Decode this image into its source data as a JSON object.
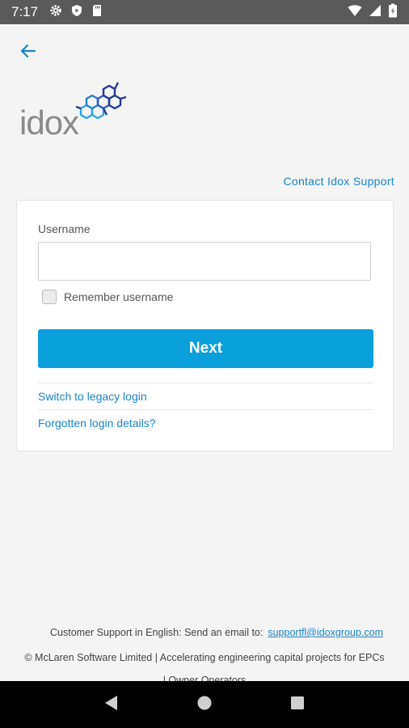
{
  "status_bar": {
    "time": "7:17",
    "left_icons": [
      "gear-icon",
      "shield-play-icon",
      "sd-card-icon"
    ],
    "right_icons": [
      "wifi-icon",
      "signal-icon",
      "battery-icon"
    ]
  },
  "header": {
    "back_icon": "arrow-left-icon",
    "logo_text": "idox",
    "contact_link": "Contact Idox Support"
  },
  "login_form": {
    "username_label": "Username",
    "username_value": "",
    "remember_label": "Remember username",
    "remember_checked": false,
    "next_label": "Next",
    "legacy_link": "Switch to legacy login",
    "forgotten_link": "Forgotten login details?"
  },
  "footer": {
    "support_text": "Customer Support in English: Send an email to:",
    "support_email": "supportfl@idoxgroup.com",
    "copyright": "© McLaren Software Limited | Accelerating engineering capital projects for EPCs",
    "cut_line": "| Owner Operators"
  },
  "nav_bar": {
    "buttons": [
      "back-triangle-icon",
      "home-circle-icon",
      "recents-square-icon"
    ]
  },
  "colors": {
    "accent": "#0aa0dc",
    "link": "#1a84c9",
    "status_bar": "#5a5a5a"
  }
}
